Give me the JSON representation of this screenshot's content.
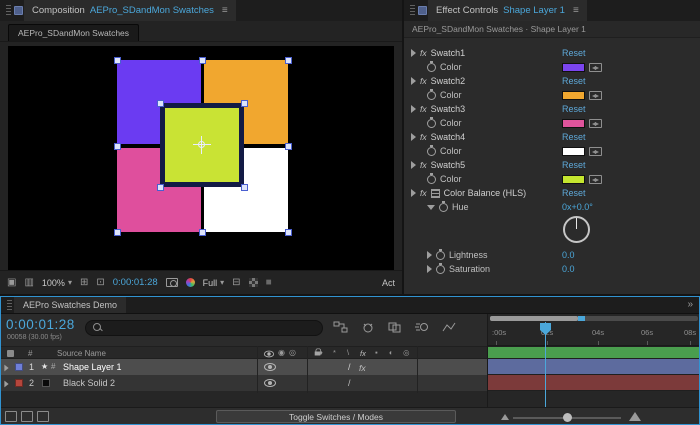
{
  "colors": {
    "accent": "#4BA7DA",
    "active_panel_border": "#3193D1"
  },
  "icons": {
    "hamburger": "≡",
    "caret": "▾",
    "monitor": "▣",
    "dual_view": "▥",
    "safe_guides": "⊞",
    "roi": "⊡",
    "region": "⊟",
    "exposure": "■",
    "panel_chevrons": "»",
    "audio": "◉",
    "solo": "◎"
  },
  "comp": {
    "tab_prefix": "Composition",
    "tab_title": "AEPro_SDandMon Swatches",
    "nav_tab": "AEPro_SDandMon Swatches",
    "toolbar": {
      "zoom": "100%",
      "timecode": "0:00:01:28",
      "resolution": "Full",
      "clipped": "Act"
    },
    "squares": {
      "purple": "#6B3BF2",
      "orange": "#F1A72F",
      "pink": "#DF4F9D",
      "white": "#FFFFFF",
      "center_fill": "#C9E334",
      "center_border": "#131B45"
    }
  },
  "fx": {
    "tab_prefix": "Effect Controls",
    "tab_title": "Shape Layer 1",
    "breadcrumb": "AEPro_SDandMon Swatches · Shape Layer 1",
    "badge": "fx",
    "reset": "Reset",
    "color_label": "Color",
    "effects": [
      {
        "name": "Swatch1",
        "swatch": "#7B45EF"
      },
      {
        "name": "Swatch2",
        "swatch": "#F1A72F"
      },
      {
        "name": "Swatch3",
        "swatch": "#E0549C"
      },
      {
        "name": "Swatch4",
        "swatch": "#FFFFFF"
      },
      {
        "name": "Swatch5",
        "swatch": "#C5E62F"
      }
    ],
    "hls": {
      "name": "Color Balance (HLS)",
      "hue_label": "Hue",
      "hue_value": "0x+0.0°",
      "lightness_label": "Lightness",
      "lightness_value": "0.0",
      "saturation_label": "Saturation",
      "saturation_value": "0.0"
    }
  },
  "timeline": {
    "tab": "AEPro Swatches Demo",
    "timecode": "0:00:01:28",
    "frame_info": "00058 (30.00 fps)",
    "search_placeholder": "",
    "col_hash": "#",
    "col_source_name": "Source Name",
    "switch_header": [
      "♦",
      "*",
      "\\",
      "fx",
      "▪",
      "◐",
      "◎"
    ],
    "layers": [
      {
        "index": "1",
        "name": "Shape Layer 1",
        "label_color": "#6F7FD8",
        "bar_color": "#5D6B9E",
        "quality": "/",
        "fx_badge": "fx",
        "icon": "★",
        "icon2": "#"
      },
      {
        "index": "2",
        "name": "Black Solid 2",
        "label_color": "#B5463C",
        "bar_color": "#7C3A3A",
        "quality": "/"
      }
    ],
    "ruler": [
      ":00s",
      "02s",
      "04s",
      "06s",
      "08s"
    ],
    "work_area_color": "#4A9E4E",
    "toggle_button": "Toggle Switches / Modes"
  }
}
